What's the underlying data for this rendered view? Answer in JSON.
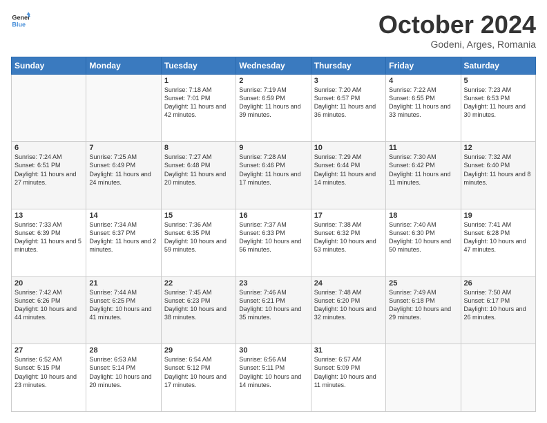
{
  "logo": {
    "line1": "General",
    "line2": "Blue"
  },
  "header": {
    "month": "October 2024",
    "location": "Godeni, Arges, Romania"
  },
  "weekdays": [
    "Sunday",
    "Monday",
    "Tuesday",
    "Wednesday",
    "Thursday",
    "Friday",
    "Saturday"
  ],
  "weeks": [
    [
      {
        "day": "",
        "sunrise": "",
        "sunset": "",
        "daylight": ""
      },
      {
        "day": "",
        "sunrise": "",
        "sunset": "",
        "daylight": ""
      },
      {
        "day": "1",
        "sunrise": "Sunrise: 7:18 AM",
        "sunset": "Sunset: 7:01 PM",
        "daylight": "Daylight: 11 hours and 42 minutes."
      },
      {
        "day": "2",
        "sunrise": "Sunrise: 7:19 AM",
        "sunset": "Sunset: 6:59 PM",
        "daylight": "Daylight: 11 hours and 39 minutes."
      },
      {
        "day": "3",
        "sunrise": "Sunrise: 7:20 AM",
        "sunset": "Sunset: 6:57 PM",
        "daylight": "Daylight: 11 hours and 36 minutes."
      },
      {
        "day": "4",
        "sunrise": "Sunrise: 7:22 AM",
        "sunset": "Sunset: 6:55 PM",
        "daylight": "Daylight: 11 hours and 33 minutes."
      },
      {
        "day": "5",
        "sunrise": "Sunrise: 7:23 AM",
        "sunset": "Sunset: 6:53 PM",
        "daylight": "Daylight: 11 hours and 30 minutes."
      }
    ],
    [
      {
        "day": "6",
        "sunrise": "Sunrise: 7:24 AM",
        "sunset": "Sunset: 6:51 PM",
        "daylight": "Daylight: 11 hours and 27 minutes."
      },
      {
        "day": "7",
        "sunrise": "Sunrise: 7:25 AM",
        "sunset": "Sunset: 6:49 PM",
        "daylight": "Daylight: 11 hours and 24 minutes."
      },
      {
        "day": "8",
        "sunrise": "Sunrise: 7:27 AM",
        "sunset": "Sunset: 6:48 PM",
        "daylight": "Daylight: 11 hours and 20 minutes."
      },
      {
        "day": "9",
        "sunrise": "Sunrise: 7:28 AM",
        "sunset": "Sunset: 6:46 PM",
        "daylight": "Daylight: 11 hours and 17 minutes."
      },
      {
        "day": "10",
        "sunrise": "Sunrise: 7:29 AM",
        "sunset": "Sunset: 6:44 PM",
        "daylight": "Daylight: 11 hours and 14 minutes."
      },
      {
        "day": "11",
        "sunrise": "Sunrise: 7:30 AM",
        "sunset": "Sunset: 6:42 PM",
        "daylight": "Daylight: 11 hours and 11 minutes."
      },
      {
        "day": "12",
        "sunrise": "Sunrise: 7:32 AM",
        "sunset": "Sunset: 6:40 PM",
        "daylight": "Daylight: 11 hours and 8 minutes."
      }
    ],
    [
      {
        "day": "13",
        "sunrise": "Sunrise: 7:33 AM",
        "sunset": "Sunset: 6:39 PM",
        "daylight": "Daylight: 11 hours and 5 minutes."
      },
      {
        "day": "14",
        "sunrise": "Sunrise: 7:34 AM",
        "sunset": "Sunset: 6:37 PM",
        "daylight": "Daylight: 11 hours and 2 minutes."
      },
      {
        "day": "15",
        "sunrise": "Sunrise: 7:36 AM",
        "sunset": "Sunset: 6:35 PM",
        "daylight": "Daylight: 10 hours and 59 minutes."
      },
      {
        "day": "16",
        "sunrise": "Sunrise: 7:37 AM",
        "sunset": "Sunset: 6:33 PM",
        "daylight": "Daylight: 10 hours and 56 minutes."
      },
      {
        "day": "17",
        "sunrise": "Sunrise: 7:38 AM",
        "sunset": "Sunset: 6:32 PM",
        "daylight": "Daylight: 10 hours and 53 minutes."
      },
      {
        "day": "18",
        "sunrise": "Sunrise: 7:40 AM",
        "sunset": "Sunset: 6:30 PM",
        "daylight": "Daylight: 10 hours and 50 minutes."
      },
      {
        "day": "19",
        "sunrise": "Sunrise: 7:41 AM",
        "sunset": "Sunset: 6:28 PM",
        "daylight": "Daylight: 10 hours and 47 minutes."
      }
    ],
    [
      {
        "day": "20",
        "sunrise": "Sunrise: 7:42 AM",
        "sunset": "Sunset: 6:26 PM",
        "daylight": "Daylight: 10 hours and 44 minutes."
      },
      {
        "day": "21",
        "sunrise": "Sunrise: 7:44 AM",
        "sunset": "Sunset: 6:25 PM",
        "daylight": "Daylight: 10 hours and 41 minutes."
      },
      {
        "day": "22",
        "sunrise": "Sunrise: 7:45 AM",
        "sunset": "Sunset: 6:23 PM",
        "daylight": "Daylight: 10 hours and 38 minutes."
      },
      {
        "day": "23",
        "sunrise": "Sunrise: 7:46 AM",
        "sunset": "Sunset: 6:21 PM",
        "daylight": "Daylight: 10 hours and 35 minutes."
      },
      {
        "day": "24",
        "sunrise": "Sunrise: 7:48 AM",
        "sunset": "Sunset: 6:20 PM",
        "daylight": "Daylight: 10 hours and 32 minutes."
      },
      {
        "day": "25",
        "sunrise": "Sunrise: 7:49 AM",
        "sunset": "Sunset: 6:18 PM",
        "daylight": "Daylight: 10 hours and 29 minutes."
      },
      {
        "day": "26",
        "sunrise": "Sunrise: 7:50 AM",
        "sunset": "Sunset: 6:17 PM",
        "daylight": "Daylight: 10 hours and 26 minutes."
      }
    ],
    [
      {
        "day": "27",
        "sunrise": "Sunrise: 6:52 AM",
        "sunset": "Sunset: 5:15 PM",
        "daylight": "Daylight: 10 hours and 23 minutes."
      },
      {
        "day": "28",
        "sunrise": "Sunrise: 6:53 AM",
        "sunset": "Sunset: 5:14 PM",
        "daylight": "Daylight: 10 hours and 20 minutes."
      },
      {
        "day": "29",
        "sunrise": "Sunrise: 6:54 AM",
        "sunset": "Sunset: 5:12 PM",
        "daylight": "Daylight: 10 hours and 17 minutes."
      },
      {
        "day": "30",
        "sunrise": "Sunrise: 6:56 AM",
        "sunset": "Sunset: 5:11 PM",
        "daylight": "Daylight: 10 hours and 14 minutes."
      },
      {
        "day": "31",
        "sunrise": "Sunrise: 6:57 AM",
        "sunset": "Sunset: 5:09 PM",
        "daylight": "Daylight: 10 hours and 11 minutes."
      },
      {
        "day": "",
        "sunrise": "",
        "sunset": "",
        "daylight": ""
      },
      {
        "day": "",
        "sunrise": "",
        "sunset": "",
        "daylight": ""
      }
    ]
  ]
}
